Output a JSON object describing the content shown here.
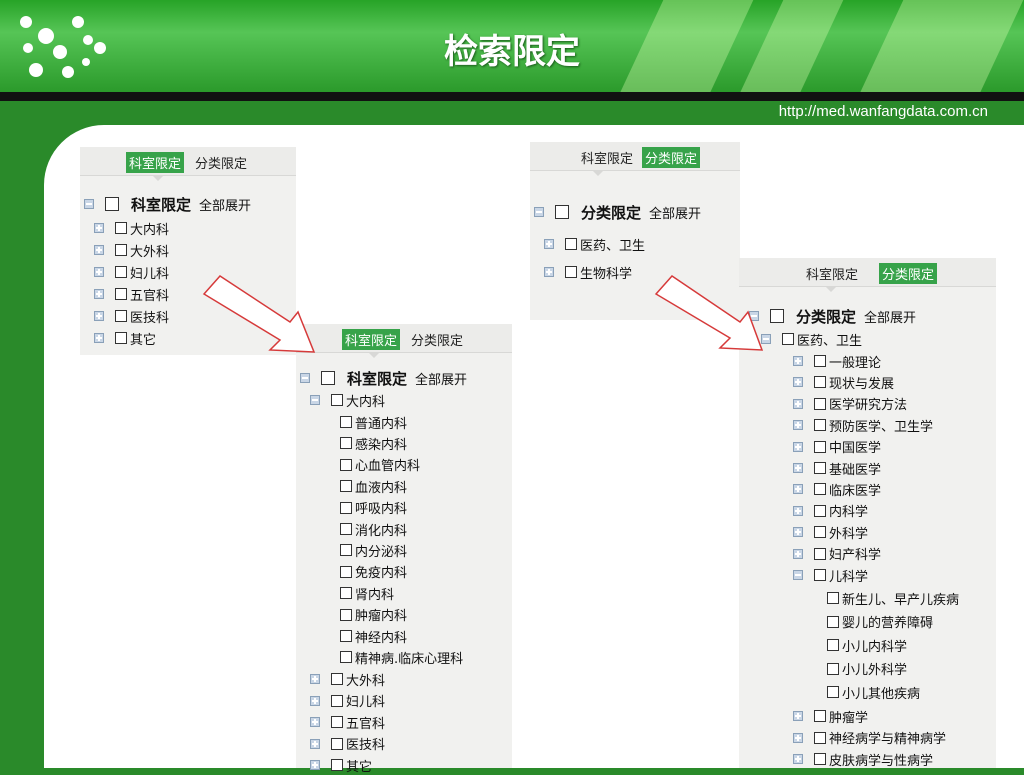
{
  "slide": {
    "title": "检索限定",
    "url": "http://med.wanfangdata.com.cn"
  },
  "panel1": {
    "tabs": [
      "科室限定",
      "分类限定"
    ],
    "root": "科室限定",
    "expand": "全部展开",
    "items": [
      "大内科",
      "大外科",
      "妇儿科",
      "五官科",
      "医技科",
      "其它"
    ]
  },
  "panel2": {
    "tabs": [
      "科室限定",
      "分类限定"
    ],
    "root": "科室限定",
    "expand": "全部展开",
    "parent": "大内科",
    "children": [
      "普通内科",
      "感染内科",
      "心血管内科",
      "血液内科",
      "呼吸内科",
      "消化内科",
      "内分泌科",
      "免疫内科",
      "肾内科",
      "肿瘤内科",
      "神经内科",
      "精神病.临床心理科"
    ],
    "rest": [
      "大外科",
      "妇儿科",
      "五官科",
      "医技科",
      "其它"
    ]
  },
  "panel3": {
    "tabs": [
      "科室限定",
      "分类限定"
    ],
    "root": "分类限定",
    "expand": "全部展开",
    "items": [
      "医药、卫生",
      "生物科学"
    ]
  },
  "panel4": {
    "tabs": [
      "科室限定",
      "分类限定"
    ],
    "root": "分类限定",
    "expand": "全部展开",
    "parent": "医药、卫生",
    "items": [
      "一般理论",
      "现状与发展",
      "医学研究方法",
      "预防医学、卫生学",
      "中国医学",
      "基础医学",
      "临床医学",
      "内科学",
      "外科学",
      "妇产科学"
    ],
    "expanded": "儿科学",
    "sub": [
      "新生儿、早产儿疾病",
      "婴儿的营养障碍",
      "小儿内科学",
      "小儿外科学",
      "小儿其他疾病"
    ],
    "after": [
      "肿瘤学",
      "神经病学与精神病学",
      "皮肤病学与性病学"
    ]
  }
}
